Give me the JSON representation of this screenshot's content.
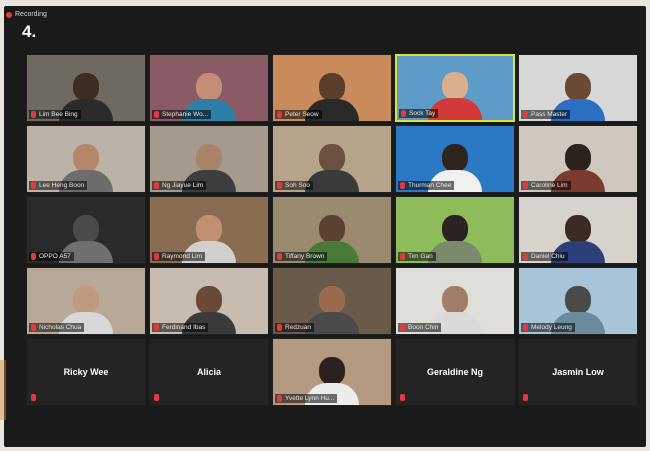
{
  "recording_label": "Recording",
  "slide_number": "4.",
  "colors": {
    "muted_mic": "#e0393e",
    "active_speaker": "#d7e43a",
    "background": "#1a1a1a"
  },
  "tiles": [
    {
      "name": "Lim Bee Bing",
      "bg": "#6e6a62",
      "head": "#3d2c22",
      "body": "#2b2b2b"
    },
    {
      "name": "Stephanie Wo...",
      "bg": "#8a5a66",
      "head": "#c48e76",
      "body": "#2d7fa7"
    },
    {
      "name": "Peter Seow",
      "bg": "#c98a5c",
      "head": "#5a3d2b",
      "body": "#2a2a2a"
    },
    {
      "name": "Sock Tay",
      "bg": "#5e9bc8",
      "head": "#d8b08e",
      "body": "#d23a3a",
      "active": true
    },
    {
      "name": "Pass Master",
      "bg": "#d7d7d7",
      "head": "#6b4a34",
      "body": "#2a6fc4"
    },
    {
      "name": "Lee Heng Boon",
      "bg": "#bcb3a8",
      "head": "#b5876a",
      "body": "#6d6d6d"
    },
    {
      "name": "Ng Jiayue Lim",
      "bg": "#a59a8c",
      "head": "#a9826b",
      "body": "#3d3d3d"
    },
    {
      "name": "Soh Soo",
      "bg": "#b6a48a",
      "head": "#6b5140",
      "body": "#3a3a3a"
    },
    {
      "name": "Thurman Chee",
      "bg": "#2b78c5",
      "head": "#2e2520",
      "body": "#f0f0f0"
    },
    {
      "name": "Caroline Lim",
      "bg": "#cfc8bf",
      "head": "#2b221d",
      "body": "#7a3a2f"
    },
    {
      "name": "OPPO A57",
      "bg": "#2a2a2a",
      "head": "#4a4a4a",
      "body": "#6f6f6f"
    },
    {
      "name": "Raymond Lim",
      "bg": "#8a6c50",
      "head": "#c09070",
      "body": "#d0d0d0"
    },
    {
      "name": "Tiffany Brown",
      "bg": "#9a8a6e",
      "head": "#5a4130",
      "body": "#4a7a3a"
    },
    {
      "name": "Tim Gan",
      "bg": "#8ebc5a",
      "head": "#2b231f",
      "body": "#7a8a6a"
    },
    {
      "name": "Daniel Chiu",
      "bg": "#d8d2cc",
      "head": "#3a2c24",
      "body": "#2d3f7a"
    },
    {
      "name": "Nicholas Chua",
      "bg": "#b8a898",
      "head": "#c09a7e",
      "body": "#d8d8d8"
    },
    {
      "name": "Ferdinand Ibas",
      "bg": "#c8bcb0",
      "head": "#6a4a36",
      "body": "#3a3a3a"
    },
    {
      "name": "Redzuan",
      "bg": "#6a5a4a",
      "head": "#9a6a4e",
      "body": "#4a4a4a"
    },
    {
      "name": "Boon Chin",
      "bg": "#e0ded9",
      "head": "#a07e68",
      "body": "#dadada"
    },
    {
      "name": "Melody Leung",
      "bg": "#a8c4d8",
      "head": "#4a4a4a",
      "body": "#6a8aa0"
    },
    {
      "name": "Ricky Wee",
      "text_only": true
    },
    {
      "name": "Alicia",
      "text_only": true
    },
    {
      "name": "Yvette Lynn Hu...",
      "bg": "#b59a82",
      "head": "#2b2220",
      "body": "#ececec"
    },
    {
      "name": "Geraldine Ng",
      "text_only": true
    },
    {
      "name": "Jasmin Low",
      "text_only": true
    }
  ]
}
